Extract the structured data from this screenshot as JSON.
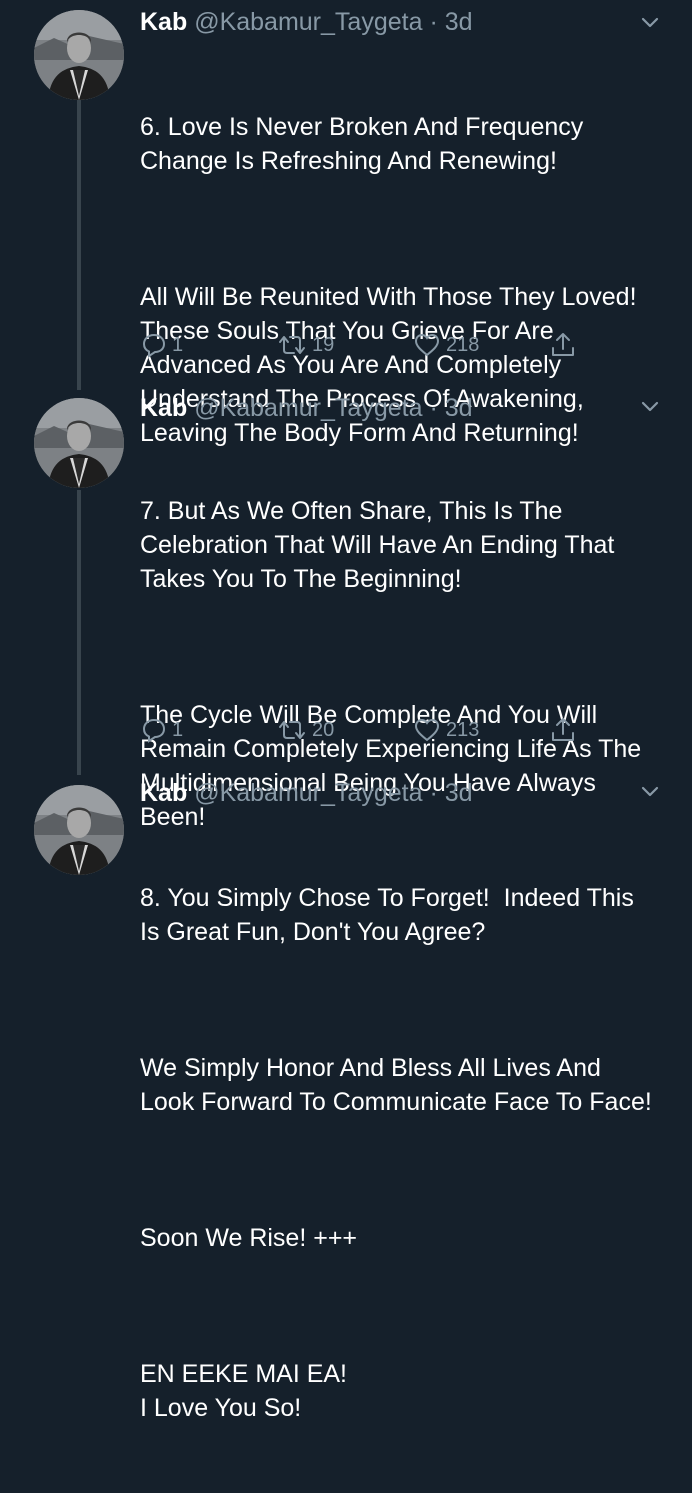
{
  "tweets": [
    {
      "name": "Kab",
      "handle": "@Kabamur_Taygeta",
      "separator": "·",
      "time": "3d",
      "paragraphs": [
        "6. Love Is Never Broken And Frequency Change Is Refreshing And Renewing!",
        "All Will Be Reunited With Those They Loved!  These Souls That You Grieve For Are Advanced As You Are And Completely Understand The Process Of Awakening, Leaving The Body Form And Returning!"
      ],
      "replies": "1",
      "retweets": "19",
      "likes": "218"
    },
    {
      "name": "Kab",
      "handle": "@Kabamur_Taygeta",
      "separator": "·",
      "time": "3d",
      "paragraphs": [
        "7. But As We Often Share, This Is The Celebration That Will Have An Ending That Takes You To The Beginning!",
        "The Cycle Will Be Complete And You Will Remain Completely Experiencing Life As The Multidimensional Being You Have Always Been!"
      ],
      "replies": "1",
      "retweets": "20",
      "likes": "213"
    },
    {
      "name": "Kab",
      "handle": "@Kabamur_Taygeta",
      "separator": "·",
      "time": "3d",
      "paragraphs": [
        "8. You Simply Chose To Forget!  Indeed This Is Great Fun, Don't You Agree?",
        "We Simply Honor And Bless All Lives And Look Forward To Communicate Face To Face!",
        "Soon We Rise! +++",
        "EN EEKE MAI EA!\nI Love You So!"
      ]
    }
  ],
  "icons": {
    "reply": "reply-icon",
    "retweet": "retweet-icon",
    "like": "heart-icon",
    "share": "share-icon",
    "more": "chevron-down-icon"
  },
  "colors": {
    "background": "#15202b",
    "secondary_text": "#8899a6",
    "thread_line": "#38444d"
  }
}
